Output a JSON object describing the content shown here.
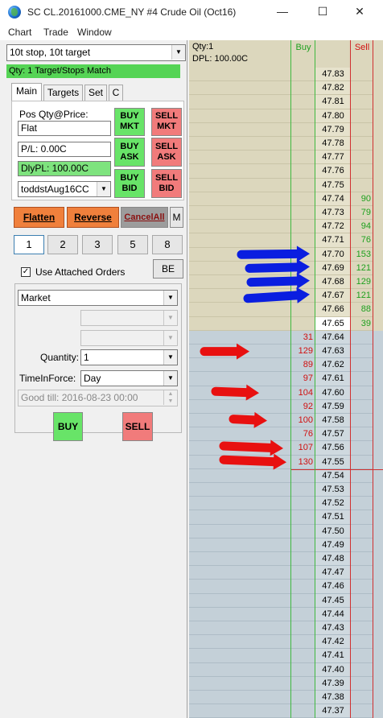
{
  "window": {
    "title": "SC CL.20161000.CME_NY  #4  Crude Oil (Oct16)",
    "minimize": "—",
    "maximize": "☐",
    "close": "✕"
  },
  "menu": [
    "Chart",
    "Trade",
    "Window"
  ],
  "attached_orders_select": "10t stop, 10t target",
  "status_banner": "Qty: 1 Target/Stops Match",
  "tabs": [
    "Main",
    "Targets",
    "Set",
    "C"
  ],
  "main_tab": {
    "pos_label": "Pos Qty@Price:",
    "pos_value": "Flat",
    "pl_value": "P/L: 0.00C",
    "dly_pl_value": "DlyPL: 100.00C",
    "account": "toddstAug16CC",
    "buy_mkt": [
      "BUY",
      "MKT"
    ],
    "sell_mkt": [
      "SELL",
      "MKT"
    ],
    "buy_ask": [
      "BUY",
      "ASK"
    ],
    "sell_ask": [
      "SELL",
      "ASK"
    ],
    "buy_bid": [
      "BUY",
      "BID"
    ],
    "sell_bid": [
      "SELL",
      "BID"
    ]
  },
  "actions": {
    "flatten": "Flatten",
    "reverse": "Reverse",
    "cancel_all": "CancelAll",
    "m": "M"
  },
  "quantity_buttons": [
    "1",
    "2",
    "3",
    "5",
    "8"
  ],
  "attached_orders_checkbox": {
    "label": "Use Attached Orders",
    "checked": "✓"
  },
  "be_button": "BE",
  "order": {
    "type": "Market",
    "quantity_label": "Quantity:",
    "quantity": "1",
    "tif_label": "TimeInForce:",
    "tif": "Day",
    "good_till": "Good till: 2016-08-23 00:00",
    "buy": "BUY",
    "sell": "SELL"
  },
  "dom": {
    "qty_header": "Qty:1",
    "dpl_header": "DPL: 100.00C",
    "buy_header": "Buy",
    "sell_header": "Sell",
    "current_price": "47.65",
    "rows": [
      {
        "price": "47.83",
        "buy": "",
        "sell": ""
      },
      {
        "price": "47.82",
        "buy": "",
        "sell": ""
      },
      {
        "price": "47.81",
        "buy": "",
        "sell": ""
      },
      {
        "price": "47.80",
        "buy": "",
        "sell": ""
      },
      {
        "price": "47.79",
        "buy": "",
        "sell": ""
      },
      {
        "price": "47.78",
        "buy": "",
        "sell": ""
      },
      {
        "price": "47.77",
        "buy": "",
        "sell": ""
      },
      {
        "price": "47.76",
        "buy": "",
        "sell": ""
      },
      {
        "price": "47.75",
        "buy": "",
        "sell": ""
      },
      {
        "price": "47.74",
        "buy": "",
        "sell": "90"
      },
      {
        "price": "47.73",
        "buy": "",
        "sell": "79"
      },
      {
        "price": "47.72",
        "buy": "",
        "sell": "94"
      },
      {
        "price": "47.71",
        "buy": "",
        "sell": "76"
      },
      {
        "price": "47.70",
        "buy": "",
        "sell": "153"
      },
      {
        "price": "47.69",
        "buy": "",
        "sell": "121"
      },
      {
        "price": "47.68",
        "buy": "",
        "sell": "129"
      },
      {
        "price": "47.67",
        "buy": "",
        "sell": "121"
      },
      {
        "price": "47.66",
        "buy": "",
        "sell": "88"
      },
      {
        "price": "47.65",
        "buy": "",
        "sell": "39"
      },
      {
        "price": "47.64",
        "buy": "31",
        "sell": ""
      },
      {
        "price": "47.63",
        "buy": "129",
        "sell": ""
      },
      {
        "price": "47.62",
        "buy": "89",
        "sell": ""
      },
      {
        "price": "47.61",
        "buy": "97",
        "sell": ""
      },
      {
        "price": "47.60",
        "buy": "104",
        "sell": ""
      },
      {
        "price": "47.59",
        "buy": "92",
        "sell": ""
      },
      {
        "price": "47.58",
        "buy": "100",
        "sell": ""
      },
      {
        "price": "47.57",
        "buy": "76",
        "sell": ""
      },
      {
        "price": "47.56",
        "buy": "107",
        "sell": ""
      },
      {
        "price": "47.55",
        "buy": "130",
        "sell": ""
      },
      {
        "price": "47.54",
        "buy": "",
        "sell": ""
      },
      {
        "price": "47.53",
        "buy": "",
        "sell": ""
      },
      {
        "price": "47.52",
        "buy": "",
        "sell": ""
      },
      {
        "price": "47.51",
        "buy": "",
        "sell": ""
      },
      {
        "price": "47.50",
        "buy": "",
        "sell": ""
      },
      {
        "price": "47.49",
        "buy": "",
        "sell": ""
      },
      {
        "price": "47.48",
        "buy": "",
        "sell": ""
      },
      {
        "price": "47.47",
        "buy": "",
        "sell": ""
      },
      {
        "price": "47.46",
        "buy": "",
        "sell": ""
      },
      {
        "price": "47.45",
        "buy": "",
        "sell": ""
      },
      {
        "price": "47.44",
        "buy": "",
        "sell": ""
      },
      {
        "price": "47.43",
        "buy": "",
        "sell": ""
      },
      {
        "price": "47.42",
        "buy": "",
        "sell": ""
      },
      {
        "price": "47.41",
        "buy": "",
        "sell": ""
      },
      {
        "price": "47.40",
        "buy": "",
        "sell": ""
      },
      {
        "price": "47.39",
        "buy": "",
        "sell": ""
      },
      {
        "price": "47.38",
        "buy": "",
        "sell": ""
      },
      {
        "price": "47.37",
        "buy": "",
        "sell": ""
      }
    ],
    "blue_arrow_prices": [
      "47.70",
      "47.69",
      "47.68",
      "47.67"
    ],
    "red_arrow_prices": [
      "47.63",
      "47.60",
      "47.58",
      "47.56",
      "47.55"
    ]
  },
  "colors": {
    "buy_green": "#68e468",
    "sell_red": "#f17b7b",
    "ask_zone": "#dcd7bd",
    "bid_zone": "#c4d0d8",
    "annotation_blue": "#0a1ee0",
    "annotation_red": "#e81010"
  }
}
